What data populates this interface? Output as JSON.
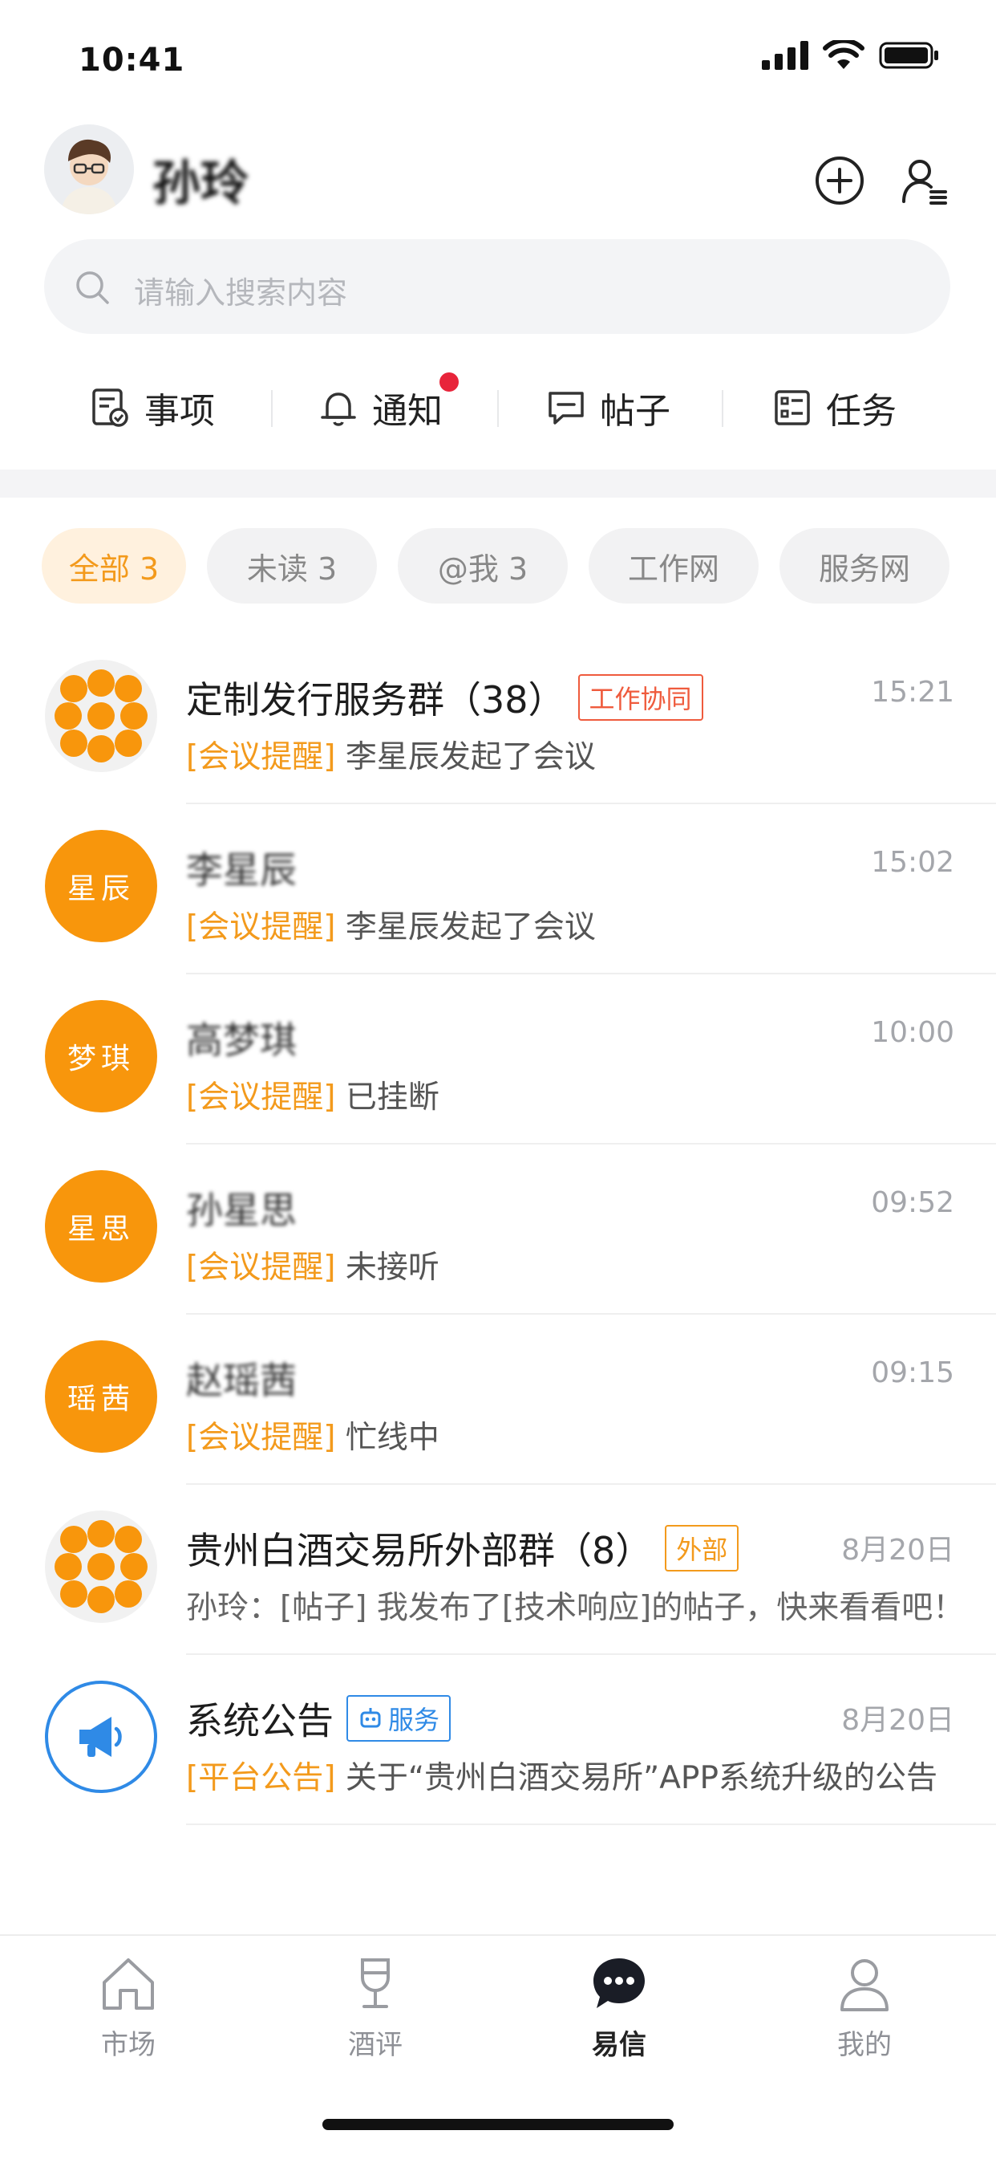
{
  "status": {
    "time": "10:41"
  },
  "header": {
    "username": "孙玲"
  },
  "search": {
    "placeholder": "请输入搜索内容"
  },
  "categories": [
    {
      "label": "事项",
      "icon": "checklist-icon"
    },
    {
      "label": "通知",
      "icon": "bell-icon",
      "has_dot": true
    },
    {
      "label": "帖子",
      "icon": "message-square-icon"
    },
    {
      "label": "任务",
      "icon": "task-list-icon"
    }
  ],
  "filters": [
    {
      "label": "全部 3",
      "active": true
    },
    {
      "label": "未读 3"
    },
    {
      "label": "@我 3"
    },
    {
      "label": "工作网"
    },
    {
      "label": "服务网"
    }
  ],
  "conversations": [
    {
      "name": "定制发行服务群（38）",
      "badge": "工作协同",
      "time": "15:21",
      "prefix": "[会议提醒]",
      "message": "李星辰发起了会议",
      "avatar": "group"
    },
    {
      "name": "李星辰",
      "time": "15:02",
      "prefix": "[会议提醒]",
      "message": "李星辰发起了会议",
      "avatar_text": "星辰"
    },
    {
      "name": "高梦琪",
      "time": "10:00",
      "prefix": "[会议提醒]",
      "message": "已挂断",
      "avatar_text": "梦琪"
    },
    {
      "name": "孙星思",
      "time": "09:52",
      "prefix": "[会议提醒]",
      "message": "未接听",
      "avatar_text": "星思"
    },
    {
      "name": "赵瑶茜",
      "time": "09:15",
      "prefix": "[会议提醒]",
      "message": "忙线中",
      "avatar_text": "瑶茜"
    },
    {
      "name": "贵州白酒交易所外部群（8）",
      "badge": "外部",
      "time": "8月20日",
      "message": "孙玲：[帖子] 我发布了[技术响应]的帖子，快来看看吧！",
      "avatar": "group"
    },
    {
      "name": "系统公告",
      "badge": "服务",
      "time": "8月20日",
      "prefix": "[平台公告]",
      "message": "关于“贵州白酒交易所”APP系统升级的公告",
      "avatar": "announcement"
    }
  ],
  "tabs": [
    {
      "label": "市场",
      "icon": "home-icon"
    },
    {
      "label": "酒评",
      "icon": "wine-glass-icon"
    },
    {
      "label": "易信",
      "icon": "chat-bubble-icon",
      "active": true
    },
    {
      "label": "我的",
      "icon": "user-icon"
    }
  ],
  "colors": {
    "accent": "#f39a1c",
    "avatar_orange": "#f8960c",
    "badge_red": "#ef5b3d",
    "service_blue": "#2f8ae6",
    "dot_red": "#e8243a"
  }
}
